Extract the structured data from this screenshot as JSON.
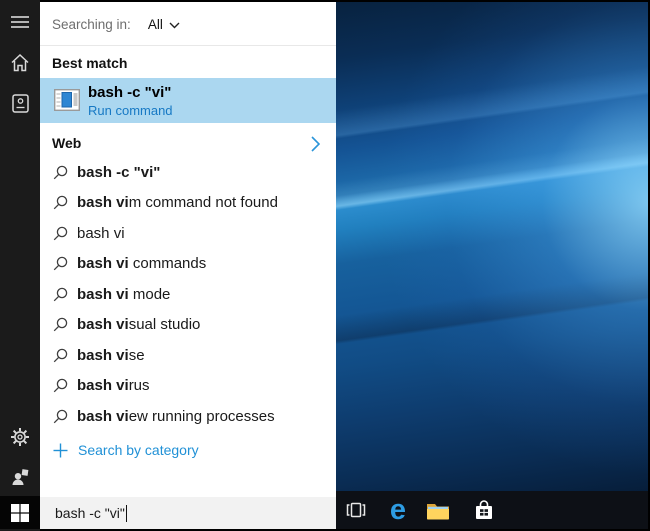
{
  "sidebar": {
    "icons": [
      "menu",
      "home",
      "notebook",
      "settings",
      "feedback",
      "windows-start"
    ]
  },
  "search_panel": {
    "scope_label": "Searching in:",
    "scope_value": "All",
    "best_match_header": "Best match",
    "best_match": {
      "title": "bash -c \"vi\"",
      "subtitle": "Run command"
    },
    "web_section": {
      "header": "Web"
    },
    "suggestions": [
      {
        "bold": "bash -c \"vi\"",
        "rest": ""
      },
      {
        "bold": "bash vi",
        "rest": "m command not found"
      },
      {
        "bold": "",
        "rest": "bash vi"
      },
      {
        "bold": "bash vi",
        "rest": " commands"
      },
      {
        "bold": "bash vi",
        "rest": " mode"
      },
      {
        "bold": "bash vi",
        "rest": "sual studio"
      },
      {
        "bold": "bash vi",
        "rest": "se"
      },
      {
        "bold": "bash vi",
        "rest": "rus"
      },
      {
        "bold": "bash vi",
        "rest": "ew running processes"
      }
    ],
    "category_link": "Search by category"
  },
  "searchbox": {
    "value": "bash -c \"vi\""
  },
  "taskbar": {
    "icons": [
      "task-view",
      "edge",
      "file-explorer",
      "store"
    ]
  },
  "colors": {
    "accent": "#0078d7",
    "link_blue": "#2191d6",
    "run_command_blue": "#1779c4",
    "highlight": "#abd7f0",
    "sidebar_bg": "#1b1b1b",
    "taskbar_bg": "#0d1016"
  }
}
